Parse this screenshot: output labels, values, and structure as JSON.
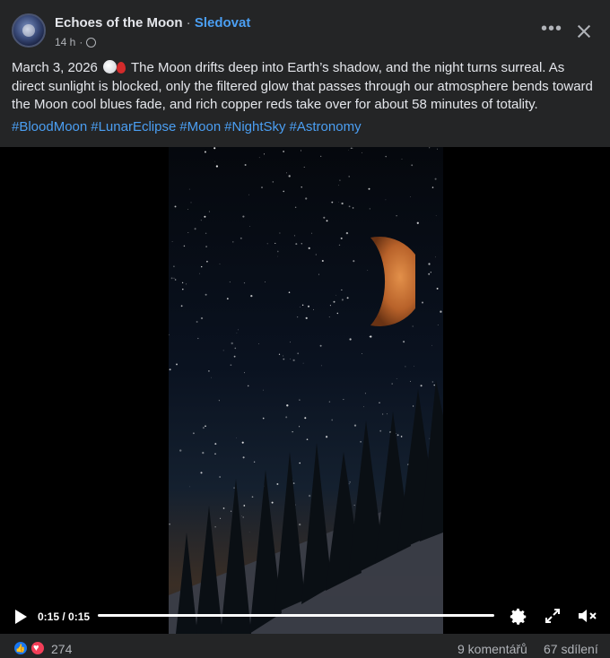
{
  "post": {
    "page_name": "Echoes of the Moon",
    "separator": " · ",
    "follow_label": "Sledovat",
    "time_ago": "14 h",
    "meta_separator": " · ",
    "text_date": "March 3, 2026",
    "text_body_1": "The Moon drifts deep into Earth’s shadow, and the night turns surreal. As direct sunlight is blocked, only the filtered glow that passes through our atmosphere bends toward the Moon cool blues fade, and rich copper reds take over for about 58 minutes of totality.",
    "hashtags": [
      "#BloodMoon",
      "#LunarEclipse",
      "#Moon",
      "#NightSky",
      "#Astronomy"
    ]
  },
  "video": {
    "time_display": "0:15 / 0:15",
    "progress_fraction": 1.0,
    "icons": [
      "play-icon",
      "gear-icon",
      "expand-icon",
      "mute-icon"
    ]
  },
  "footer": {
    "reaction_count": "274",
    "comments_label": "9 komentářů",
    "shares_label": "67 sdílení"
  },
  "colors": {
    "background": "#242526",
    "link": "#4b9ff3",
    "text": "#e4e6eb",
    "secondary": "#b0b3b8",
    "like": "#1877f2",
    "love": "#f33e58"
  }
}
